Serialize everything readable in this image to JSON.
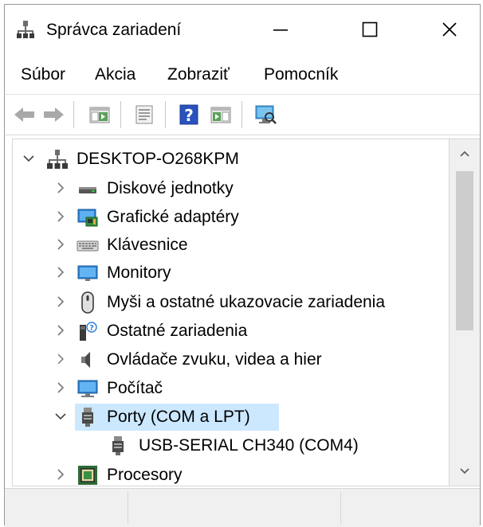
{
  "window": {
    "title": "Správca zariadení",
    "controls": {
      "minimize": "minimize",
      "maximize": "maximize",
      "close": "close"
    }
  },
  "menu": [
    {
      "label": "Súbor"
    },
    {
      "label": "Akcia"
    },
    {
      "label": "Zobraziť"
    },
    {
      "label": "Pomocník"
    }
  ],
  "toolbar": [
    {
      "icon": "back-arrow-icon"
    },
    {
      "icon": "forward-arrow-icon"
    },
    {
      "icon": "show-hide-console-tree-icon"
    },
    {
      "icon": "properties-icon"
    },
    {
      "icon": "help-icon"
    },
    {
      "icon": "run-icon"
    },
    {
      "icon": "scan-hardware-icon"
    }
  ],
  "tree": {
    "root": {
      "label": "DESKTOP-O268KPM",
      "expanded": true,
      "icon": "computer-tree-icon"
    },
    "items": [
      {
        "label": "Diskové jednotky",
        "icon": "disk-drive-icon",
        "expanded": false
      },
      {
        "label": "Grafické adaptéry",
        "icon": "display-adapter-icon",
        "expanded": false
      },
      {
        "label": "Klávesnice",
        "icon": "keyboard-icon",
        "expanded": false
      },
      {
        "label": "Monitory",
        "icon": "monitor-icon",
        "expanded": false
      },
      {
        "label": "Myši a ostatné ukazovacie zariadenia",
        "icon": "mouse-icon",
        "expanded": false
      },
      {
        "label": "Ostatné zariadenia",
        "icon": "other-devices-icon",
        "expanded": false
      },
      {
        "label": "Ovládače zvuku, videa a hier",
        "icon": "speaker-icon",
        "expanded": false
      },
      {
        "label": "Počítač",
        "icon": "computer-icon",
        "expanded": false
      },
      {
        "label": "Porty (COM a LPT)",
        "icon": "port-icon",
        "expanded": true,
        "selected": true,
        "children": [
          {
            "label": "USB-SERIAL CH340 (COM4)",
            "icon": "port-icon"
          }
        ]
      },
      {
        "label": "Procesory",
        "icon": "processor-icon",
        "expanded": false
      }
    ]
  },
  "colors": {
    "selection": "#cce8ff",
    "accent": "#0078d7"
  }
}
